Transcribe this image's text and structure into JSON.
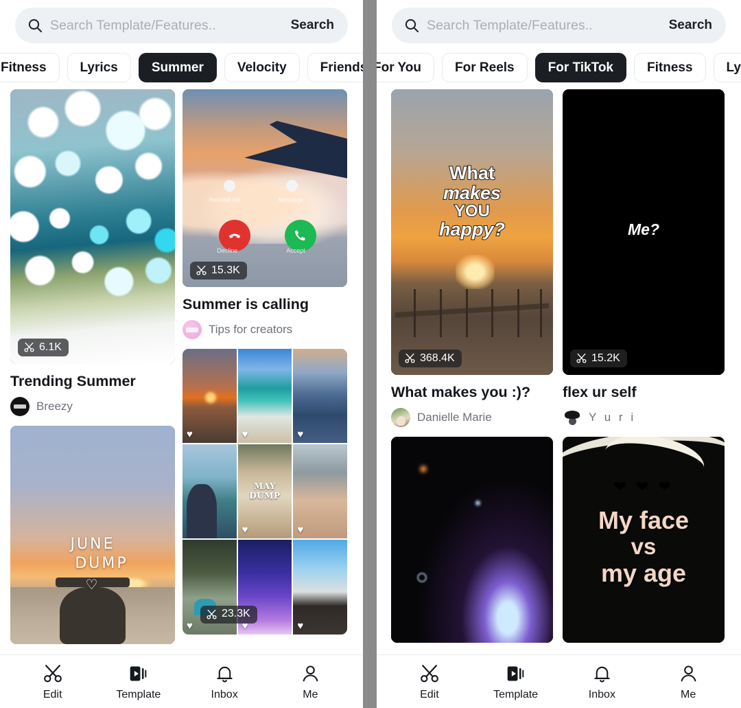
{
  "search": {
    "placeholder": "Search Template/Features..",
    "button_label": "Search",
    "icon": "search-icon"
  },
  "left_panel": {
    "chips": [
      {
        "label": "Fitness",
        "active": false
      },
      {
        "label": "Lyrics",
        "active": false
      },
      {
        "label": "Summer",
        "active": true
      },
      {
        "label": "Velocity",
        "active": false
      },
      {
        "label": "Friends",
        "active": false
      }
    ],
    "cards": [
      {
        "title": "Trending Summer",
        "author": "Breezy",
        "uses": "6.1K",
        "uses_icon": "scissors-icon",
        "avatar": "breezy-avatar"
      },
      {
        "title": "Summer is calling",
        "author": "Tips for creators",
        "uses": "15.3K",
        "uses_icon": "scissors-icon",
        "avatar": "tips-for-creators-avatar",
        "overlay_labels": [
          "Remind me",
          "Message",
          "Decline",
          "Accept"
        ]
      },
      {
        "title": "",
        "author": "",
        "uses": "",
        "overlay_text": [
          "JUNE",
          "DUMP"
        ],
        "heart": "♡"
      },
      {
        "title": "",
        "author": "",
        "uses": "23.3K",
        "uses_icon": "scissors-icon",
        "collage_text": [
          "MAY",
          "DUMP"
        ],
        "heart": "♥"
      }
    ]
  },
  "right_panel": {
    "chips": [
      {
        "label": "For You",
        "active": false
      },
      {
        "label": "For Reels",
        "active": false
      },
      {
        "label": "For TikTok",
        "active": true
      },
      {
        "label": "Fitness",
        "active": false
      },
      {
        "label": "Lyrics",
        "active": false
      }
    ],
    "cards": [
      {
        "title": "What makes you :)?",
        "author": "Danielle Marie",
        "uses": "368.4K",
        "uses_icon": "scissors-icon",
        "avatar": "danielle-marie-avatar",
        "overlay_text": [
          "What",
          "makes",
          "YOU",
          "happy?"
        ]
      },
      {
        "title": "flex ur self",
        "author": "Y u r i",
        "uses": "15.2K",
        "uses_icon": "scissors-icon",
        "avatar": "yuri-avatar",
        "overlay_text": [
          "Me?"
        ]
      },
      {
        "title": "",
        "author": "",
        "uses": ""
      },
      {
        "title": "",
        "author": "",
        "uses": "",
        "overlay_text": [
          "My face",
          "vs",
          "my age"
        ],
        "hearts": "❤ ❤ ❤"
      }
    ]
  },
  "bottom_nav": {
    "items": [
      {
        "label": "Edit",
        "icon": "scissors-icon",
        "active": false
      },
      {
        "label": "Template",
        "icon": "template-play-icon",
        "active": true
      },
      {
        "label": "Inbox",
        "icon": "bell-icon",
        "active": false
      },
      {
        "label": "Me",
        "icon": "person-icon",
        "active": false
      }
    ]
  },
  "colors": {
    "accent_dark": "#1b1f24",
    "search_bg": "#eef1f4",
    "chip_border": "#e7e9ec",
    "muted_text": "#6d7178",
    "divider": "#8a8a8a"
  }
}
